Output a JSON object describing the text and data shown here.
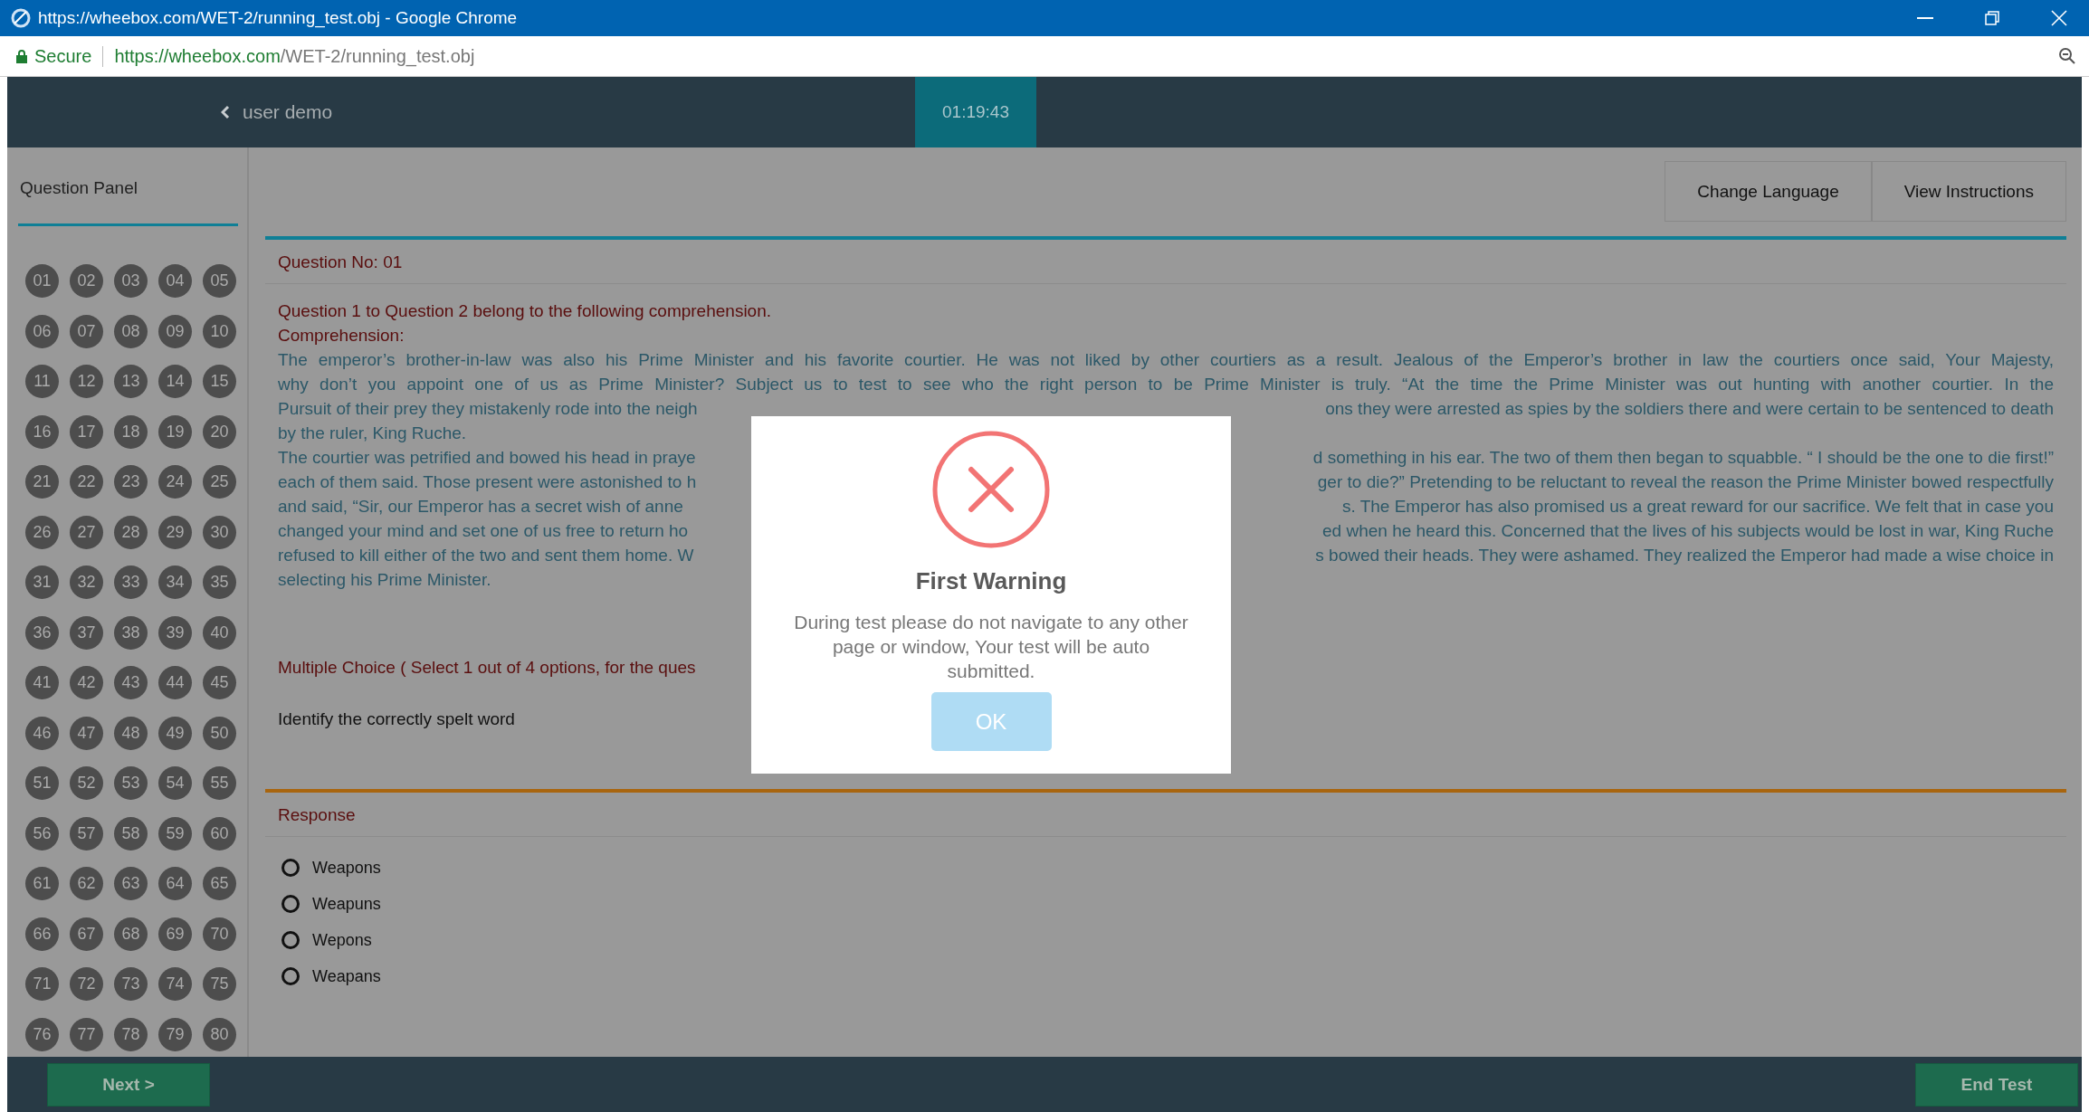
{
  "window": {
    "title": "https://wheebox.com/WET-2/running_test.obj - Google Chrome"
  },
  "address_bar": {
    "secure_label": "Secure",
    "url_host": "https://wheebox.com",
    "url_path": "/WET-2/running_test.obj"
  },
  "header": {
    "user": "user demo",
    "timer": "01:19:43"
  },
  "question_panel": {
    "title": "Question Panel",
    "numbers": [
      "01",
      "02",
      "03",
      "04",
      "05",
      "06",
      "07",
      "08",
      "09",
      "10",
      "11",
      "12",
      "13",
      "14",
      "15",
      "16",
      "17",
      "18",
      "19",
      "20",
      "21",
      "22",
      "23",
      "24",
      "25",
      "26",
      "27",
      "28",
      "29",
      "30",
      "31",
      "32",
      "33",
      "34",
      "35",
      "36",
      "37",
      "38",
      "39",
      "40",
      "41",
      "42",
      "43",
      "44",
      "45",
      "46",
      "47",
      "48",
      "49",
      "50",
      "51",
      "52",
      "53",
      "54",
      "55",
      "56",
      "57",
      "58",
      "59",
      "60",
      "61",
      "62",
      "63",
      "64",
      "65",
      "66",
      "67",
      "68",
      "69",
      "70",
      "71",
      "72",
      "73",
      "74",
      "75",
      "76",
      "77",
      "78",
      "79",
      "80"
    ]
  },
  "toolbar": {
    "buttons": [
      "Change Language",
      "View Instructions"
    ]
  },
  "question": {
    "number_label": "Question No: 01",
    "intro": "Question 1 to Question 2 belong to the following comprehension.",
    "comprehension_label": "Comprehension:",
    "passage_lines": [
      {
        "kind": "full",
        "left": "The emperor’s brother-in-law was also his Prime Minister and his favorite courtier. He was not liked by other courtiers as a result. Jealous of the Emperor’s brother in law the courtiers once said, Your Majesty,"
      },
      {
        "kind": "full",
        "left": "why don’t you appoint one of us as Prime Minister? Subject us to test to see who the right person to be Prime Minister is truly. “At the time the Prime Minister was out hunting with another courtier. In the"
      },
      {
        "kind": "split",
        "left": "Pursuit of their prey they mistakenly rode into the neigh",
        "right": "ons they were arrested as spies by the soldiers there and were certain to be sentenced to death"
      },
      {
        "kind": "end",
        "left": "by the ruler, King Ruche."
      },
      {
        "kind": "split",
        "left": "The courtier was petrified and bowed his head in praye",
        "right": "d something in his ear. The two of them then began to squabble. “ I should be the one to die first!”"
      },
      {
        "kind": "split",
        "left": "each of them said. Those present were astonished to h",
        "right": "ger to die?” Pretending to be reluctant to reveal the reason the Prime Minister bowed respectfully"
      },
      {
        "kind": "split",
        "left": "and said, “Sir, our Emperor has a secret wish of anne",
        "right": "s. The Emperor has also promised us a great reward for our sacrifice. We felt that in case you"
      },
      {
        "kind": "split",
        "left": "changed your mind and set one of us free to return ho",
        "right": "ed when he heard this. Concerned that the lives of his subjects would be lost in war, King Ruche"
      },
      {
        "kind": "split",
        "left": "refused to kill either of the two and sent them home. W",
        "right": "s bowed their heads. They were ashamed. They realized the Emperor had made a wise choice in"
      },
      {
        "kind": "end",
        "left": "selecting his Prime Minister."
      }
    ],
    "type_label": "Multiple Choice ( Select 1 out of 4 options, for the ques",
    "prompt": "Identify the correctly spelt word"
  },
  "response": {
    "title": "Response",
    "options": [
      {
        "label": "Weapons",
        "selected": false
      },
      {
        "label": "Weapuns",
        "selected": false
      },
      {
        "label": "Wepons",
        "selected": false
      },
      {
        "label": "Weapans",
        "selected": false
      }
    ]
  },
  "footer": {
    "next": "Next >",
    "end": "End Test"
  },
  "dialog": {
    "title": "First Warning",
    "message": "During test please do not navigate to any other page or window, Your test will be auto submitted.",
    "ok": "OK"
  }
}
